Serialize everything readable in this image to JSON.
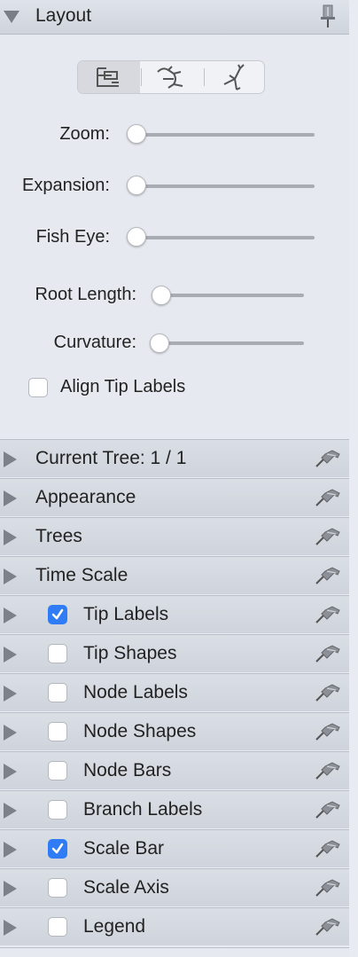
{
  "layout": {
    "title": "Layout",
    "sliders": [
      {
        "label": "Zoom:",
        "value": 0
      },
      {
        "label": "Expansion:",
        "value": 0
      },
      {
        "label": "Fish Eye:",
        "value": 0
      },
      {
        "label": "Root Length:",
        "value": 0
      },
      {
        "label": "Curvature:",
        "value": 0
      }
    ],
    "layout_modes": [
      "rectangular-tree-icon",
      "polar-tree-icon",
      "radial-tree-icon"
    ],
    "selected_mode": "rectangular-tree-icon",
    "align_tip_labels": {
      "label": "Align Tip Labels",
      "checked": false
    }
  },
  "panels": [
    {
      "label": "Current Tree: 1 / 1"
    },
    {
      "label": "Appearance"
    },
    {
      "label": "Trees"
    },
    {
      "label": "Time Scale"
    },
    {
      "label": "Tip Labels",
      "checked": true
    },
    {
      "label": "Tip Shapes",
      "checked": false
    },
    {
      "label": "Node Labels",
      "checked": false
    },
    {
      "label": "Node Shapes",
      "checked": false
    },
    {
      "label": "Node Bars",
      "checked": false
    },
    {
      "label": "Branch Labels",
      "checked": false
    },
    {
      "label": "Scale Bar",
      "checked": true
    },
    {
      "label": "Scale Axis",
      "checked": false
    },
    {
      "label": "Legend",
      "checked": false
    }
  ],
  "colors": {
    "checkbox_on": "#2f7cf6",
    "header_bg": "#d3d7de",
    "panel_bg": "#e6e9ef"
  }
}
